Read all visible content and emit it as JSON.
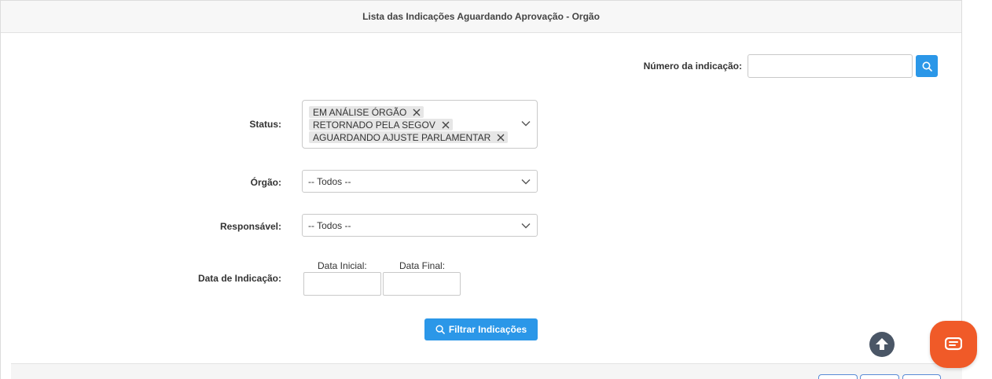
{
  "header": {
    "title": "Lista das Indicações Aguardando Aprovação - Orgão"
  },
  "numero": {
    "label": "Número da indicação:",
    "value": ""
  },
  "status": {
    "label": "Status:",
    "tags": [
      "EM ANÁLISE ÓRGÃO",
      "RETORNADO PELA SEGOV",
      "AGUARDANDO AJUSTE PARLAMENTAR"
    ]
  },
  "orgao": {
    "label": "Órgão:",
    "selected": "-- Todos --"
  },
  "responsavel": {
    "label": "Responsável:",
    "selected": "-- Todos --"
  },
  "data_indicacao": {
    "label": "Data de Indicação:",
    "inicial_label": "Data Inicial:",
    "final_label": "Data Final:",
    "inicial_value": "",
    "final_value": ""
  },
  "actions": {
    "filter_label": "Filtrar Indicações"
  },
  "colors": {
    "primary": "#2b97e8",
    "chat": "#f05a28",
    "scroll_top": "#4a5666"
  },
  "icons": {
    "search": "search-icon",
    "chevron": "chevron-down-icon",
    "remove": "close-icon",
    "scroll": "arrow-up-icon",
    "chat": "chat-icon"
  }
}
